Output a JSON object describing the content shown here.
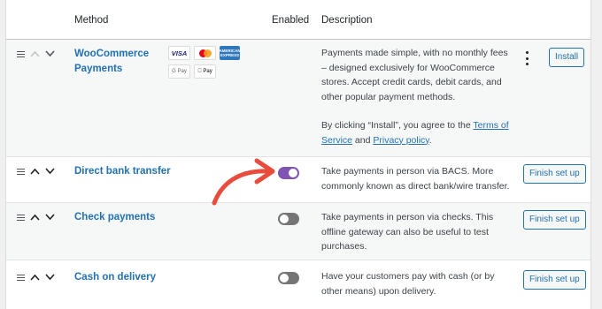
{
  "table": {
    "headers": {
      "method": "Method",
      "enabled": "Enabled",
      "description": "Description"
    },
    "rows": [
      {
        "method": "WooCommerce Payments",
        "enabled": null,
        "description": "Payments made simple, with no monthly fees – designed exclusively for WooCommerce stores. Accept credit cards, debit cards, and other popular payment methods.",
        "note_prefix": "By clicking “Install”, you agree to the ",
        "note_link1": "Terms of Service",
        "note_mid": " and ",
        "note_link2": "Privacy policy",
        "note_suffix": ".",
        "action": "Install",
        "logos": {
          "visa": "VISA",
          "amex": "AMERICAN EXPRESS",
          "gpay": "G Pay",
          "apay": " Pay"
        }
      },
      {
        "method": "Direct bank transfer",
        "enabled": true,
        "description": "Take payments in person via BACS. More commonly known as direct bank/wire transfer.",
        "action": "Finish set up"
      },
      {
        "method": "Check payments",
        "enabled": false,
        "description": "Take payments in person via checks. This offline gateway can also be useful to test purchases.",
        "action": "Finish set up"
      },
      {
        "method": "Cash on delivery",
        "enabled": false,
        "description": "Have your customers pay with cash (or by other means) upon delivery.",
        "action": "Finish set up"
      }
    ]
  },
  "colors": {
    "link": "#2271b1",
    "toggle_on": "#7f54b3",
    "toggle_off": "#757575",
    "annotation_arrow": "#e74c3c"
  },
  "icons": [
    "drag-handle-icon",
    "chevron-up-icon",
    "chevron-down-icon",
    "more-vertical-icon",
    "annotation-arrow-icon"
  ]
}
